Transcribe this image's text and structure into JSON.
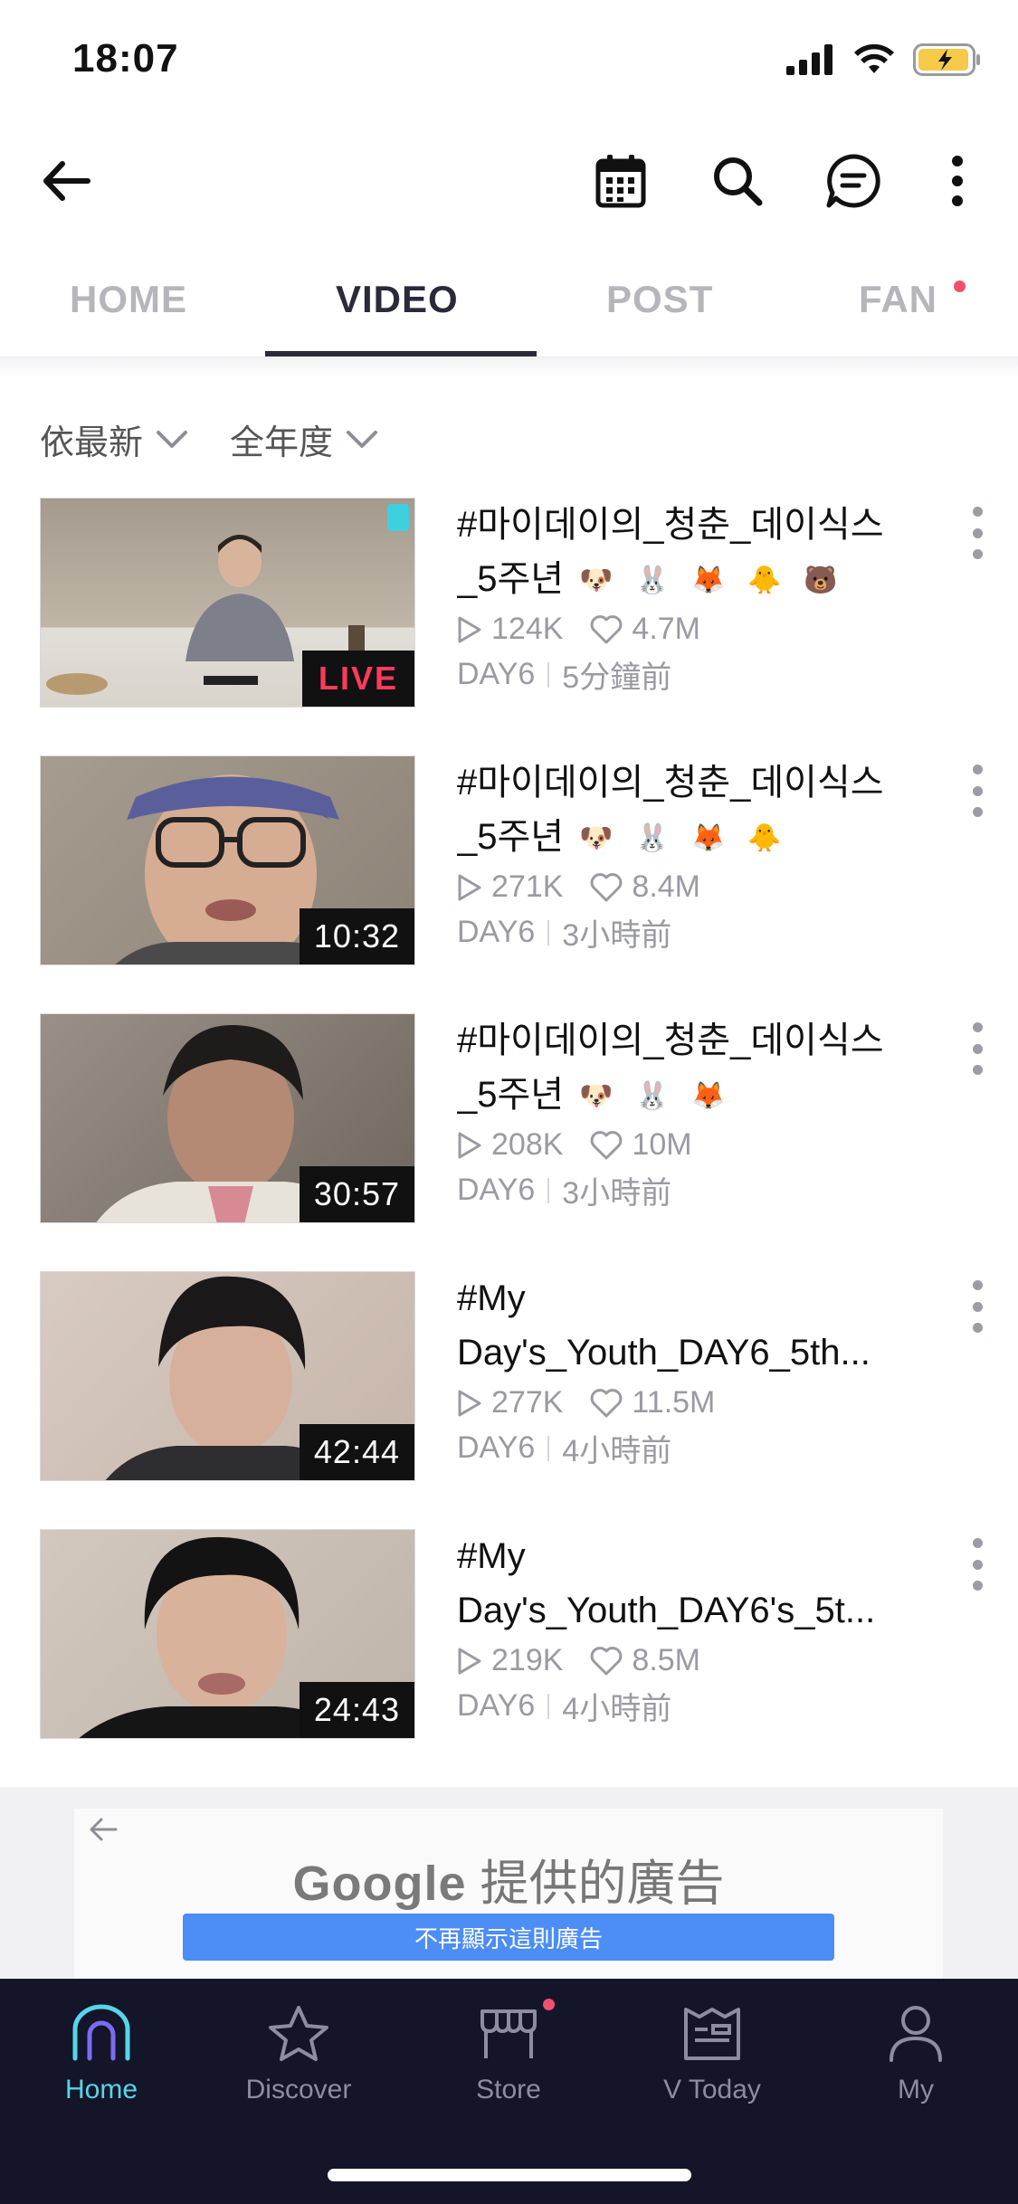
{
  "status_bar": {
    "time": "18:07"
  },
  "tabs": [
    {
      "label": "HOME"
    },
    {
      "label": "VIDEO"
    },
    {
      "label": "POST"
    },
    {
      "label": "FAN"
    }
  ],
  "filters": {
    "sort": "依最新",
    "year": "全年度"
  },
  "videos": [
    {
      "title": "#마이데이의_청춘_데이식스",
      "title_line2": "_5주년",
      "emojis": [
        "🐶",
        "🐰",
        "🦊",
        "🐥",
        "🐻"
      ],
      "badge": "LIVE",
      "plays": "124K",
      "likes": "4.7M",
      "channel": "DAY6",
      "time": "5分鐘前"
    },
    {
      "title": "#마이데이의_청춘_데이식스",
      "title_line2": "_5주년",
      "emojis": [
        "🐶",
        "🐰",
        "🦊",
        "🐥"
      ],
      "badge": "10:32",
      "plays": "271K",
      "likes": "8.4M",
      "channel": "DAY6",
      "time": "3小時前"
    },
    {
      "title": "#마이데이의_청춘_데이식스",
      "title_line2": "_5주년",
      "emojis": [
        "🐶",
        "🐰",
        "🦊"
      ],
      "badge": "30:57",
      "plays": "208K",
      "likes": "10M",
      "channel": "DAY6",
      "time": "3小時前"
    },
    {
      "title": "#My",
      "title_line2": "Day's_Youth_DAY6_5th...",
      "emojis": [],
      "badge": "42:44",
      "plays": "277K",
      "likes": "11.5M",
      "channel": "DAY6",
      "time": "4小時前"
    },
    {
      "title": "#My",
      "title_line2": "Day's_Youth_DAY6's_5t...",
      "emojis": [],
      "badge": "24:43",
      "plays": "219K",
      "likes": "8.5M",
      "channel": "DAY6",
      "time": "4小時前"
    }
  ],
  "ad": {
    "brand": "Google",
    "text": "提供的廣告",
    "button": "不再顯示這則廣告"
  },
  "tab_bar": [
    {
      "label": "Home",
      "icon": "home-icon"
    },
    {
      "label": "Discover",
      "icon": "star-icon"
    },
    {
      "label": "Store",
      "icon": "store-icon"
    },
    {
      "label": "V Today",
      "icon": "calendar-flag-icon"
    },
    {
      "label": "My",
      "icon": "person-icon"
    }
  ],
  "colors": {
    "accent": "#55d6e8",
    "live": "#ff3b5c",
    "tab_bar_bg": "#15152a",
    "notification_dot": "#f0506e",
    "ad_button": "#4c8df6"
  }
}
